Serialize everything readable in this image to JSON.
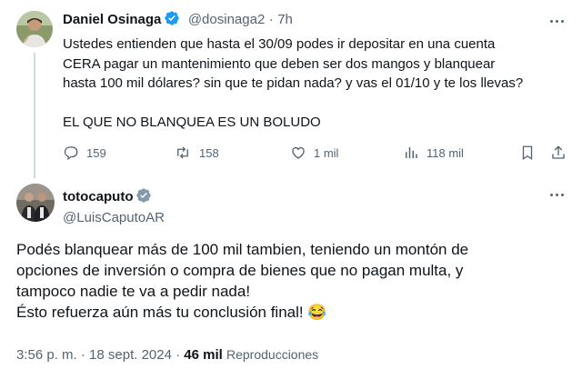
{
  "tweet1": {
    "author_name": "Daniel Osinaga",
    "handle": "@dosinaga2",
    "separator": "·",
    "time": "7h",
    "lines": [
      "Ustedes entienden que hasta el 30/09 podes ir depositar en una cuenta",
      "CERA pagar un mantenimiento que deben ser dos mangos y blanquear",
      "hasta 100 mil dólares? sin que te pidan nada? y vas el 01/10 y te los llevas?"
    ],
    "closing_line": "EL QUE NO BLANQUEA ES UN BOLUDO",
    "stats": {
      "replies": "159",
      "retweets": "158",
      "likes": "1 mil",
      "views": "118 mil"
    }
  },
  "tweet2": {
    "author_name": "totocaputo",
    "handle": "@LuisCaputoAR",
    "lines": [
      "Podés blanquear más de 100 mil tambien, teniendo un montón de",
      "opciones de inversión o compra de bienes que no pagan multa, y",
      "tampoco nadie te va a pedir nada!",
      "Ésto refuerza aún más tu conclusión final! 😂"
    ],
    "timestamp": "3:56 p. m. · 18 sept. 2024 ·",
    "views_count": "46 mil",
    "views_label": "Reproducciones"
  },
  "colors": {
    "verified_blue": "#1d9bf0",
    "verified_gray": "#829aab",
    "muted_text": "#536471",
    "thread_line": "#cfd9de"
  },
  "icons": [
    "reply-icon",
    "retweet-icon",
    "like-icon",
    "views-icon",
    "bookmark-icon",
    "share-icon",
    "more-icon",
    "verified-badge-icon"
  ]
}
